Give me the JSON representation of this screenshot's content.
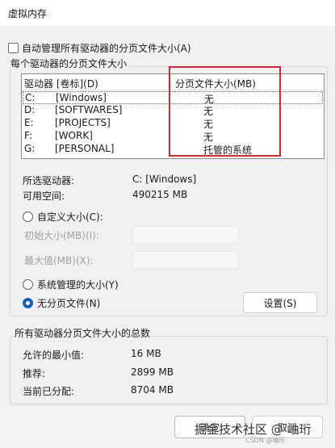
{
  "window": {
    "title": "虚拟内存"
  },
  "auto_manage": {
    "label": "自动管理所有驱动器的分页文件大小(A)",
    "checked": false
  },
  "per_drive_group": {
    "title": "每个驱动器的分页文件大小",
    "headers": {
      "drive": "驱动器 [卷标](D)",
      "size": "分页文件大小(MB)"
    },
    "rows": [
      {
        "drive": "C:",
        "label": "[Windows]",
        "size": "无",
        "selected": true
      },
      {
        "drive": "D:",
        "label": "[SOFTWARES]",
        "size": "无",
        "selected": false
      },
      {
        "drive": "E:",
        "label": "[PROJECTS]",
        "size": "无",
        "selected": false
      },
      {
        "drive": "F:",
        "label": "[WORK]",
        "size": "无",
        "selected": false
      },
      {
        "drive": "G:",
        "label": "[PERSONAL]",
        "size": "托管的系统",
        "selected": false
      }
    ],
    "selected_drive_label": "所选驱动器:",
    "selected_drive_value": "C:  [Windows]",
    "free_space_label": "可用空间:",
    "free_space_value": "490215 MB",
    "custom_size_label": "自定义大小(C):",
    "initial_size_label": "初始大小(MB)(I):",
    "max_size_label": "最大值(MB)(X):",
    "system_managed_label": "系统管理的大小(Y)",
    "no_paging_label": "无分页文件(N)",
    "selected_option": "no_paging",
    "set_button": "设置(S)"
  },
  "total_group": {
    "title": "所有驱动器分页文件大小的总数",
    "min_label": "允许的最小值:",
    "min_value": "16 MB",
    "recommended_label": "推荐:",
    "recommended_value": "2899 MB",
    "current_label": "当前已分配:",
    "current_value": "8704 MB"
  },
  "footer": {
    "ok_button": "确定",
    "cancel_button": "取消",
    "watermark": "掘金技术社区 @ 岫珩",
    "watermark_small": "CSDN @岫珩"
  }
}
